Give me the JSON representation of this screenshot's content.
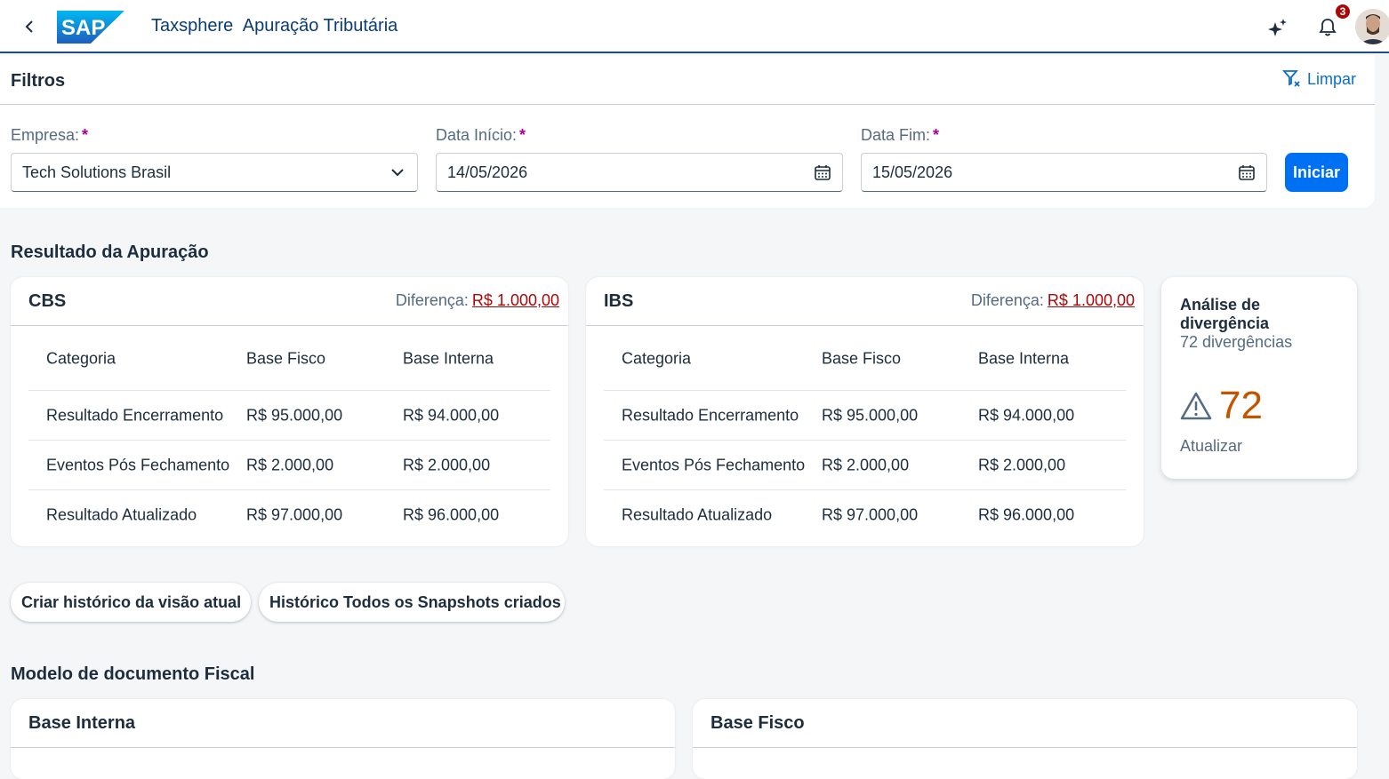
{
  "shell": {
    "logo_text": "SAP",
    "app_name": "Taxsphere",
    "app_subtitle": "Apuração Tributária",
    "notification_count": "3"
  },
  "filters": {
    "title": "Filtros",
    "clear_label": "Limpar",
    "empresa": {
      "label": "Empresa:",
      "required": "*",
      "value": "Tech Solutions Brasil"
    },
    "data_inicio": {
      "label": "Data Início:",
      "required": "*",
      "value": "14/05/2026"
    },
    "data_fim": {
      "label": "Data Fim:",
      "required": "*",
      "value": "15/05/2026"
    },
    "start_button": "Iniciar"
  },
  "resultado": {
    "title": "Resultado da Apuração",
    "diff_label": "Diferença:",
    "columns": [
      "Categoria",
      "Base Fisco",
      "Base Interna"
    ],
    "cards": [
      {
        "title": "CBS",
        "diff_value": "R$ 1.000,00",
        "rows": [
          [
            "Resultado Encerramento",
            "R$ 95.000,00",
            "R$ 94.000,00"
          ],
          [
            "Eventos Pós Fechamento",
            "R$ 2.000,00",
            "R$ 2.000,00"
          ],
          [
            "Resultado Atualizado",
            "R$ 97.000,00",
            "R$ 96.000,00"
          ]
        ]
      },
      {
        "title": "IBS",
        "diff_value": "R$ 1.000,00",
        "rows": [
          [
            "Resultado Encerramento",
            "R$ 95.000,00",
            "R$ 94.000,00"
          ],
          [
            "Eventos Pós Fechamento",
            "R$ 2.000,00",
            "R$ 2.000,00"
          ],
          [
            "Resultado Atualizado",
            "R$ 97.000,00",
            "R$ 96.000,00"
          ]
        ]
      }
    ]
  },
  "divergencia": {
    "title": "Análise de divergência",
    "subtitle": "72 divergências",
    "value": "72",
    "footer": "Atualizar",
    "value_color": "#c35500"
  },
  "actions": {
    "create_snapshot": "Criar histórico da visão atual",
    "all_snapshots": "Histórico Todos os Snapshots criados"
  },
  "modelo": {
    "title": "Modelo de documento Fiscal",
    "left_title": "Base Interna",
    "right_title": "Base Fisco"
  },
  "colors": {
    "brand": "#0070f2",
    "negative": "#aa0808",
    "shell_text": "#0a3c78"
  }
}
